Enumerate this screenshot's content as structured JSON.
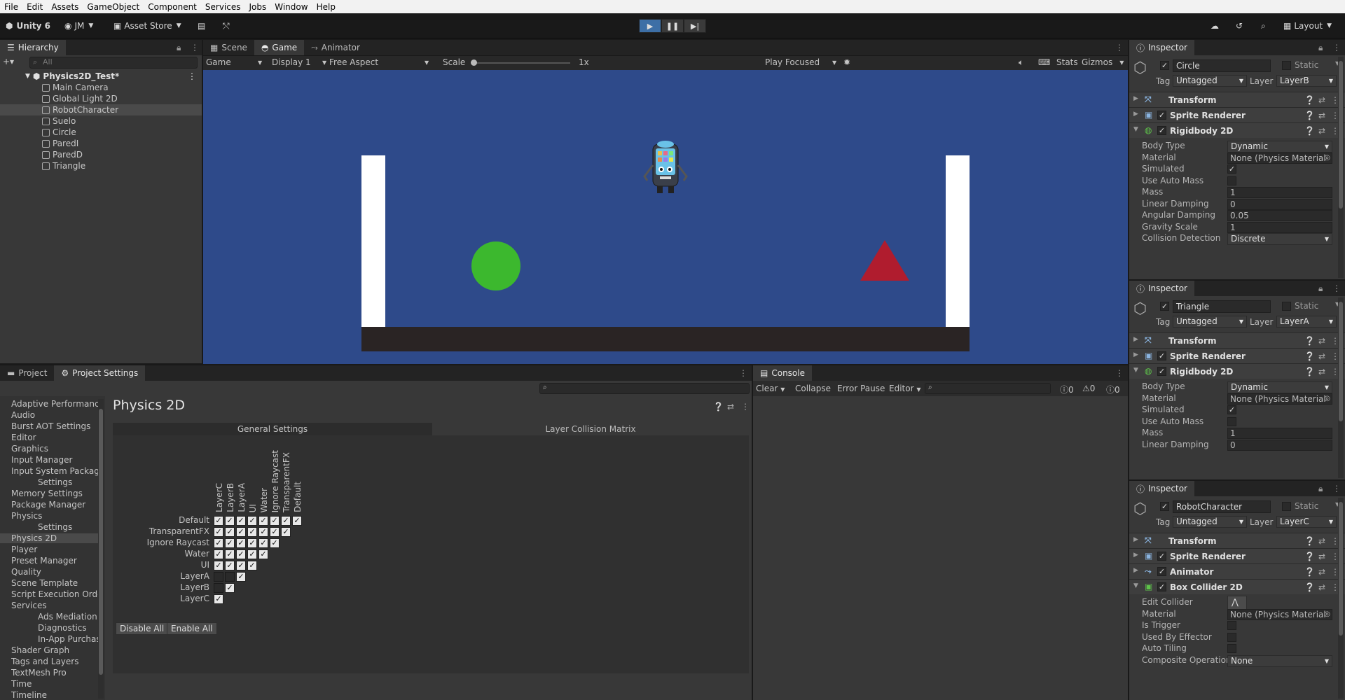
{
  "menu": [
    "File",
    "Edit",
    "Assets",
    "GameObject",
    "Component",
    "Services",
    "Jobs",
    "Window",
    "Help"
  ],
  "toolbar": {
    "unity_label": "Unity 6",
    "account": "JM",
    "asset_store": "Asset Store",
    "layout": "Layout"
  },
  "hierarchy": {
    "tab": "Hierarchy",
    "search_placeholder": "All",
    "scene": "Physics2D_Test*",
    "items": [
      "Main Camera",
      "Global Light 2D",
      "RobotCharacter",
      "Suelo",
      "Circle",
      "ParedI",
      "ParedD",
      "Triangle"
    ]
  },
  "view_tabs": [
    "Scene",
    "Game",
    "Animator"
  ],
  "game_bar": {
    "mode": "Game",
    "display": "Display 1",
    "aspect": "Free Aspect",
    "scale_label": "Scale",
    "scale_value": "1x",
    "play_focused": "Play Focused",
    "stats": "Stats",
    "gizmos": "Gizmos"
  },
  "project_tabs": [
    "Project",
    "Project Settings"
  ],
  "project_settings": {
    "title": "Physics 2D",
    "subtabs": [
      "General Settings",
      "Layer Collision Matrix"
    ],
    "list": [
      {
        "label": "Adaptive Performanc",
        "indent": 0
      },
      {
        "label": "Audio",
        "indent": 0
      },
      {
        "label": "Burst AOT Settings",
        "indent": 0
      },
      {
        "label": "Editor",
        "indent": 0
      },
      {
        "label": "Graphics",
        "indent": 0
      },
      {
        "label": "Input Manager",
        "indent": 0
      },
      {
        "label": "Input System Packag",
        "indent": 0,
        "fold": true
      },
      {
        "label": "Settings",
        "indent": 1
      },
      {
        "label": "Memory Settings",
        "indent": 0
      },
      {
        "label": "Package Manager",
        "indent": 0
      },
      {
        "label": "Physics",
        "indent": 0,
        "fold": true
      },
      {
        "label": "Settings",
        "indent": 1
      },
      {
        "label": "Physics 2D",
        "indent": 0,
        "selected": true
      },
      {
        "label": "Player",
        "indent": 0
      },
      {
        "label": "Preset Manager",
        "indent": 0
      },
      {
        "label": "Quality",
        "indent": 0
      },
      {
        "label": "Scene Template",
        "indent": 0
      },
      {
        "label": "Script Execution Orde",
        "indent": 0
      },
      {
        "label": "Services",
        "indent": 0,
        "fold": true
      },
      {
        "label": "Ads Mediation (Lev",
        "indent": 1
      },
      {
        "label": "Diagnostics",
        "indent": 1
      },
      {
        "label": "In-App Purchasing",
        "indent": 1
      },
      {
        "label": "Shader Graph",
        "indent": 0
      },
      {
        "label": "Tags and Layers",
        "indent": 0
      },
      {
        "label": "TextMesh Pro",
        "indent": 0
      },
      {
        "label": "Time",
        "indent": 0
      },
      {
        "label": "Timeline",
        "indent": 0
      }
    ],
    "matrix": {
      "layers": [
        "Default",
        "TransparentFX",
        "Ignore Raycast",
        "Water",
        "UI",
        "LayerA",
        "LayerB",
        "LayerC"
      ],
      "cols": [
        "LayerC",
        "LayerB",
        "LayerA",
        "UI",
        "Water",
        "Ignore Raycast",
        "TransparentFX",
        "Default"
      ],
      "rows": [
        [
          1,
          1,
          1,
          1,
          1,
          1,
          1,
          1
        ],
        [
          1,
          1,
          1,
          1,
          1,
          1,
          1
        ],
        [
          1,
          1,
          1,
          1,
          1,
          1
        ],
        [
          1,
          1,
          1,
          1,
          1
        ],
        [
          1,
          1,
          1,
          1
        ],
        [
          0,
          0,
          1
        ],
        [
          0,
          1
        ],
        [
          1
        ]
      ]
    },
    "buttons": [
      "Disable All",
      "Enable All"
    ]
  },
  "console": {
    "tab": "Console",
    "buttons": [
      "Clear",
      "Collapse",
      "Error Pause",
      "Editor"
    ],
    "counts": [
      "0",
      "0",
      "0"
    ]
  },
  "inspectors": [
    {
      "tab": "Inspector",
      "name": "Circle",
      "static": "Static",
      "tag": "Untagged",
      "layer": "LayerB",
      "components": [
        "Transform",
        "Sprite Renderer",
        "Rigidbody 2D"
      ],
      "props": [
        {
          "k": "Body Type",
          "v": "Dynamic",
          "t": "dd"
        },
        {
          "k": "Material",
          "v": "None (Physics Material",
          "t": "obj"
        },
        {
          "k": "Simulated",
          "v": "✓",
          "t": "chk"
        },
        {
          "k": "Use Auto Mass",
          "v": "",
          "t": "chk"
        },
        {
          "k": "Mass",
          "v": "1",
          "t": "num"
        },
        {
          "k": "Linear Damping",
          "v": "0",
          "t": "num"
        },
        {
          "k": "Angular Damping",
          "v": "0.05",
          "t": "num"
        },
        {
          "k": "Gravity Scale",
          "v": "1",
          "t": "num"
        },
        {
          "k": "Collision Detection",
          "v": "Discrete",
          "t": "dd"
        }
      ]
    },
    {
      "tab": "Inspector",
      "name": "Triangle",
      "static": "Static",
      "tag": "Untagged",
      "layer": "LayerA",
      "components": [
        "Transform",
        "Sprite Renderer",
        "Rigidbody 2D"
      ],
      "props": [
        {
          "k": "Body Type",
          "v": "Dynamic",
          "t": "dd"
        },
        {
          "k": "Material",
          "v": "None (Physics Material",
          "t": "obj"
        },
        {
          "k": "Simulated",
          "v": "✓",
          "t": "chk"
        },
        {
          "k": "Use Auto Mass",
          "v": "",
          "t": "chk"
        },
        {
          "k": "Mass",
          "v": "1",
          "t": "num"
        },
        {
          "k": "Linear Damping",
          "v": "0",
          "t": "num"
        }
      ]
    },
    {
      "tab": "Inspector",
      "name": "RobotCharacter",
      "static": "Static",
      "tag": "Untagged",
      "layer": "LayerC",
      "components": [
        "Transform",
        "Sprite Renderer",
        "Animator",
        "Box Collider 2D"
      ],
      "props": [
        {
          "k": "Edit Collider",
          "v": "",
          "t": "btn"
        },
        {
          "k": "Material",
          "v": "None (Physics Material",
          "t": "obj"
        },
        {
          "k": "Is Trigger",
          "v": "",
          "t": "chk"
        },
        {
          "k": "Used By Effector",
          "v": "",
          "t": "chk"
        },
        {
          "k": "Auto Tiling",
          "v": "",
          "t": "chk"
        },
        {
          "k": "Composite Operation",
          "v": "None",
          "t": "dd"
        }
      ]
    }
  ],
  "colors": {
    "scene_bg": "#2e4a8a",
    "circle": "#3cb82e",
    "triangle": "#b01c2e",
    "floor": "#2a2424",
    "wall": "#ffffff",
    "accent": "#3d6fa6"
  }
}
